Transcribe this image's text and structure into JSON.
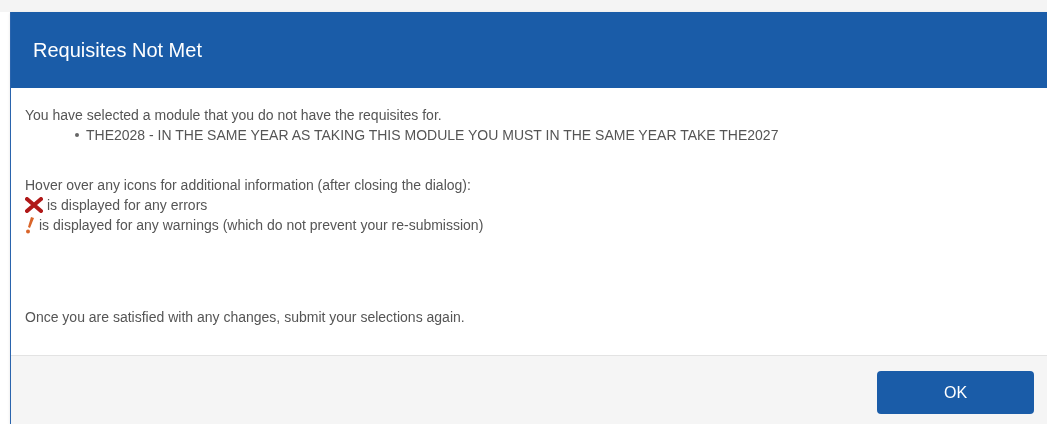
{
  "dialog": {
    "title": "Requisites Not Met",
    "intro": "You have selected a module that you do not have the requisites for.",
    "requisites": [
      "THE2028 - IN THE SAME YEAR AS TAKING THIS MODULE YOU MUST IN THE SAME YEAR TAKE THE2027"
    ],
    "hover_note": "Hover over any icons for additional information (after closing the dialog):",
    "legend": [
      {
        "kind": "error",
        "text": "is displayed for any errors"
      },
      {
        "kind": "warning",
        "text": "is displayed for any warnings (which do not prevent your re-submission)"
      }
    ],
    "closing_note": "Once you are satisfied with any changes, submit your selections again.",
    "buttons": [
      "OK"
    ]
  }
}
